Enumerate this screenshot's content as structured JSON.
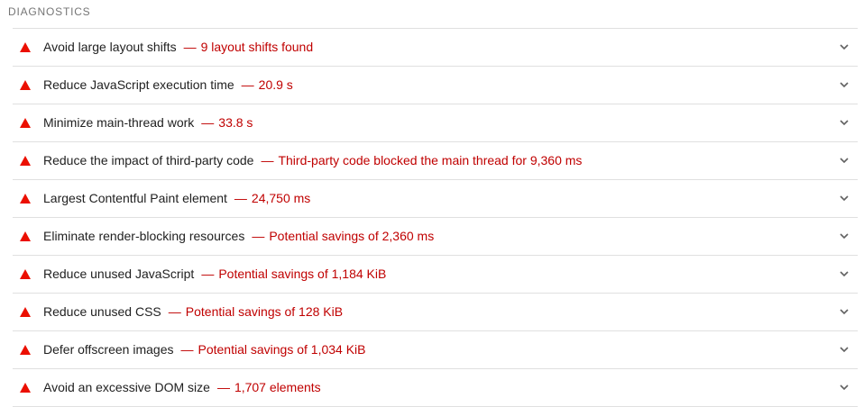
{
  "section": {
    "title": "DIAGNOSTICS"
  },
  "audits": [
    {
      "title": "Avoid large layout shifts",
      "separator": "—",
      "detail": "9 layout shifts found"
    },
    {
      "title": "Reduce JavaScript execution time",
      "separator": "—",
      "detail": "20.9 s"
    },
    {
      "title": "Minimize main-thread work",
      "separator": "—",
      "detail": "33.8 s"
    },
    {
      "title": "Reduce the impact of third-party code",
      "separator": "—",
      "detail": "Third-party code blocked the main thread for 9,360 ms"
    },
    {
      "title": "Largest Contentful Paint element",
      "separator": "—",
      "detail": "24,750 ms"
    },
    {
      "title": "Eliminate render-blocking resources",
      "separator": "—",
      "detail": "Potential savings of 2,360 ms"
    },
    {
      "title": "Reduce unused JavaScript",
      "separator": "—",
      "detail": "Potential savings of 1,184 KiB"
    },
    {
      "title": "Reduce unused CSS",
      "separator": "—",
      "detail": "Potential savings of 128 KiB"
    },
    {
      "title": "Defer offscreen images",
      "separator": "—",
      "detail": "Potential savings of 1,034 KiB"
    },
    {
      "title": "Avoid an excessive DOM size",
      "separator": "—",
      "detail": "1,707 elements"
    }
  ],
  "icons": {
    "status": "warning-triangle-icon",
    "expand": "chevron-down-icon"
  },
  "colors": {
    "fail": "#eb0f00",
    "detail_text": "#c00000",
    "title_text": "#212121",
    "section_text": "#757575",
    "divider": "#e0e0e0"
  }
}
